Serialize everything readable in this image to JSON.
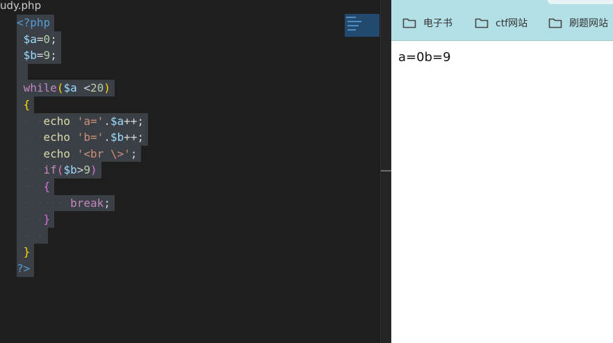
{
  "editor": {
    "tab_title": "udy.php",
    "lines": [
      {
        "ws": "",
        "tokens": [
          {
            "t": "<?php",
            "c": "t-php"
          }
        ]
      },
      {
        "ws": " ",
        "tokens": [
          {
            "t": "$a",
            "c": "t-var"
          },
          {
            "t": "=",
            "c": "t-op"
          },
          {
            "t": "0",
            "c": "t-num"
          },
          {
            "t": ";",
            "c": "t-op"
          }
        ]
      },
      {
        "ws": " ",
        "tokens": [
          {
            "t": "$b",
            "c": "t-var"
          },
          {
            "t": "=",
            "c": "t-op"
          },
          {
            "t": "9",
            "c": "t-num"
          },
          {
            "t": ";",
            "c": "t-op"
          }
        ]
      },
      {
        "ws": " ",
        "tokens": []
      },
      {
        "ws": " ",
        "tokens": [
          {
            "t": "while",
            "c": "t-kw"
          },
          {
            "t": "(",
            "c": "t-brace"
          },
          {
            "t": "$a",
            "c": "t-var"
          },
          {
            "t": " <",
            "c": "t-op"
          },
          {
            "t": "20",
            "c": "t-num"
          },
          {
            "t": ")",
            "c": "t-brace"
          }
        ]
      },
      {
        "ws": " ",
        "tokens": [
          {
            "t": "{",
            "c": "t-brace"
          }
        ]
      },
      {
        "ws": " ···",
        "tokens": [
          {
            "t": "echo",
            "c": "t-fn"
          },
          {
            "t": " ",
            "c": "t-op"
          },
          {
            "t": "'a='",
            "c": "t-str"
          },
          {
            "t": ".",
            "c": "t-op"
          },
          {
            "t": "$a",
            "c": "t-var"
          },
          {
            "t": "++;",
            "c": "t-op"
          }
        ]
      },
      {
        "ws": " ···",
        "tokens": [
          {
            "t": "echo",
            "c": "t-fn"
          },
          {
            "t": " ",
            "c": "t-op"
          },
          {
            "t": "'b='",
            "c": "t-str"
          },
          {
            "t": ".",
            "c": "t-op"
          },
          {
            "t": "$b",
            "c": "t-var"
          },
          {
            "t": "++;",
            "c": "t-op"
          }
        ]
      },
      {
        "ws": " ···",
        "tokens": [
          {
            "t": "echo",
            "c": "t-fn"
          },
          {
            "t": " ",
            "c": "t-op"
          },
          {
            "t": "'<br \\>'",
            "c": "t-str"
          },
          {
            "t": ";",
            "c": "t-op"
          }
        ]
      },
      {
        "ws": " ···",
        "tokens": [
          {
            "t": "if",
            "c": "t-kw"
          },
          {
            "t": "(",
            "c": "t-brace2"
          },
          {
            "t": "$b",
            "c": "t-var"
          },
          {
            "t": ">",
            "c": "t-op"
          },
          {
            "t": "9",
            "c": "t-num"
          },
          {
            "t": ")",
            "c": "t-brace2"
          }
        ]
      },
      {
        "ws": " ···",
        "tokens": [
          {
            "t": "{",
            "c": "t-brace2"
          }
        ]
      },
      {
        "ws": " ·······",
        "tokens": [
          {
            "t": "break",
            "c": "t-kw"
          },
          {
            "t": ";",
            "c": "t-op"
          }
        ]
      },
      {
        "ws": " ···",
        "tokens": [
          {
            "t": "}",
            "c": "t-brace2"
          }
        ]
      },
      {
        "ws": " ···",
        "tokens": []
      },
      {
        "ws": " ",
        "tokens": [
          {
            "t": "}",
            "c": "t-brace"
          }
        ]
      },
      {
        "ws": "",
        "tokens": [
          {
            "t": "?>",
            "c": "t-php"
          }
        ]
      }
    ]
  },
  "browser": {
    "bookmarks": [
      {
        "label": "电子书",
        "icon": "folder-icon"
      },
      {
        "label": "ctf网站",
        "icon": "folder-icon"
      },
      {
        "label": "刷题网站",
        "icon": "folder-icon"
      }
    ],
    "output_text": "a=0b=9"
  },
  "colors": {
    "editor_bg": "#1e1e1e",
    "selection": "#3b3f46",
    "bookmark_bar": "#b3e0e6"
  }
}
